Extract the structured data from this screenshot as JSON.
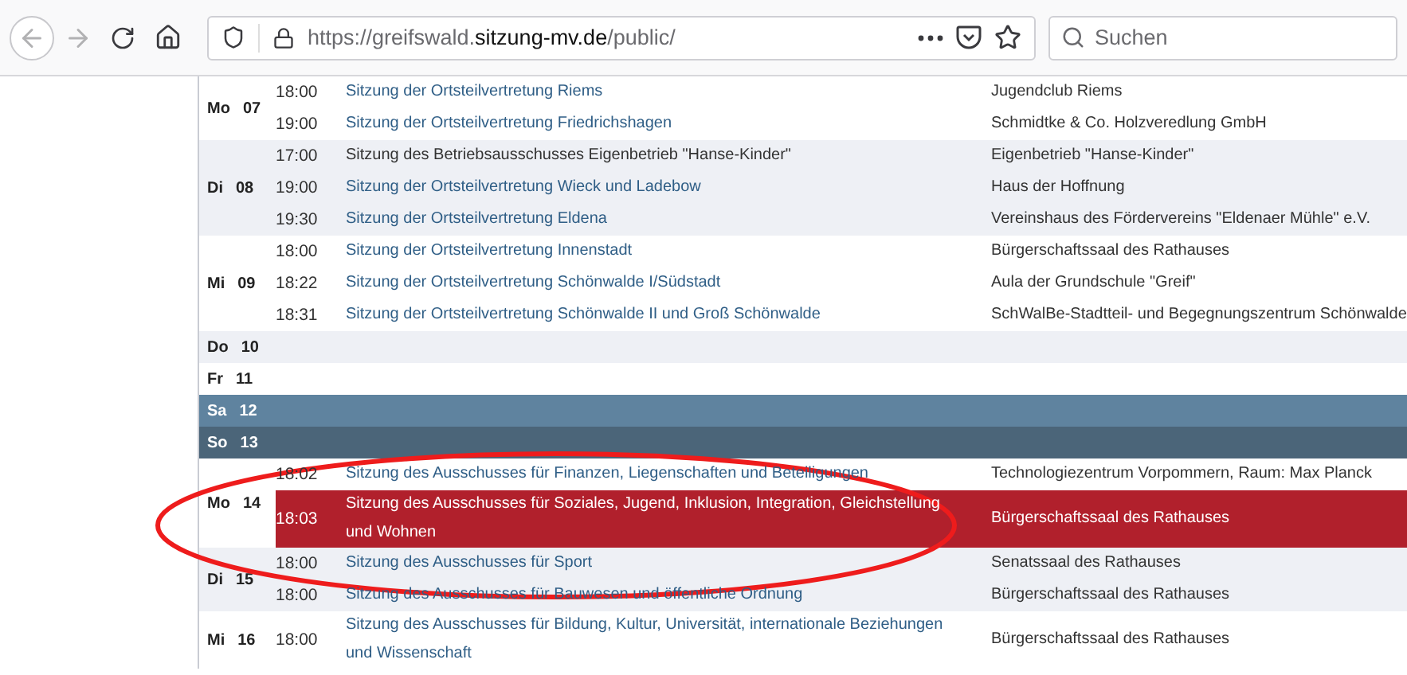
{
  "browser": {
    "url": "https://greifswald.**sitzung-mv.de**/public/",
    "search": {
      "placeholder": "Suchen"
    }
  },
  "days": [
    {
      "name": "Mo",
      "date": "07",
      "kind": "weekday",
      "shaded": false,
      "events": [
        {
          "time": "18:00",
          "title": "Sitzung der Ortsteilvertretung Riems",
          "linked": true,
          "location": "Jugendclub Riems",
          "selected": false
        },
        {
          "time": "19:00",
          "title": "Sitzung der Ortsteilvertretung Friedrichshagen",
          "linked": true,
          "location": "Schmidtke & Co. Holzveredlung GmbH",
          "selected": false
        }
      ]
    },
    {
      "name": "Di",
      "date": "08",
      "kind": "weekday",
      "shaded": true,
      "events": [
        {
          "time": "17:00",
          "title": "Sitzung des Betriebsausschusses Eigenbetrieb \"Hanse-Kinder\"",
          "linked": false,
          "location": "Eigenbetrieb \"Hanse-Kinder\"",
          "selected": false
        },
        {
          "time": "19:00",
          "title": "Sitzung der Ortsteilvertretung Wieck und Ladebow",
          "linked": true,
          "location": "Haus der Hoffnung",
          "selected": false
        },
        {
          "time": "19:30",
          "title": "Sitzung der Ortsteilvertretung Eldena",
          "linked": true,
          "location": "Vereinshaus des Fördervereins \"Eldenaer Mühle\" e.V.",
          "selected": false
        }
      ]
    },
    {
      "name": "Mi",
      "date": "09",
      "kind": "weekday",
      "shaded": false,
      "events": [
        {
          "time": "18:00",
          "title": "Sitzung der Ortsteilvertretung Innenstadt",
          "linked": true,
          "location": "Bürgerschaftssaal des Rathauses",
          "selected": false
        },
        {
          "time": "18:22",
          "title": "Sitzung der Ortsteilvertretung Schönwalde I/Südstadt",
          "linked": true,
          "location": "Aula der Grundschule \"Greif\"",
          "selected": false
        },
        {
          "time": "18:31",
          "title": "Sitzung der Ortsteilvertretung Schönwalde II und Groß Schönwalde",
          "linked": true,
          "location": "SchWalBe-Stadtteil- und Begegnungszentrum Schönwalde",
          "selected": false
        }
      ]
    },
    {
      "name": "Do",
      "date": "10",
      "kind": "weekday",
      "shaded": true
    },
    {
      "name": "Fr",
      "date": "11",
      "kind": "weekday",
      "shaded": false
    },
    {
      "name": "Sa",
      "date": "12",
      "kind": "saturday"
    },
    {
      "name": "So",
      "date": "13",
      "kind": "sunday"
    },
    {
      "name": "Mo",
      "date": "14",
      "kind": "weekday",
      "shaded": false,
      "events": [
        {
          "time": "18:02",
          "title": "Sitzung des Ausschusses für Finanzen, Liegenschaften und Beteiligungen",
          "linked": true,
          "location": "Technologiezentrum Vorpommern, Raum: Max Planck",
          "selected": false
        },
        {
          "time": "18:03",
          "title": "Sitzung des Ausschusses für Soziales, Jugend, Inklusion, Integration, Gleichstellung und Wohnen",
          "linked": true,
          "location": "Bürgerschaftssaal des Rathauses",
          "selected": true
        }
      ]
    },
    {
      "name": "Di",
      "date": "15",
      "kind": "weekday",
      "shaded": true,
      "events": [
        {
          "time": "18:00",
          "title": "Sitzung des Ausschusses für Sport",
          "linked": true,
          "location": "Senatssaal des Rathauses",
          "selected": false
        },
        {
          "time": "18:00",
          "title": "Sitzung des Ausschusses für Bauwesen und öffentliche Ordnung",
          "linked": true,
          "location": "Bürgerschaftssaal des Rathauses",
          "selected": false
        }
      ]
    },
    {
      "name": "Mi",
      "date": "16",
      "kind": "weekday",
      "shaded": false,
      "events": [
        {
          "time": "18:00",
          "title": "Sitzung des Ausschusses für Bildung, Kultur, Universität, internationale Beziehungen und Wissenschaft",
          "linked": true,
          "location": "Bürgerschaftssaal des Rathauses",
          "selected": false
        }
      ]
    }
  ],
  "annotation": {
    "kind": "ellipse"
  }
}
